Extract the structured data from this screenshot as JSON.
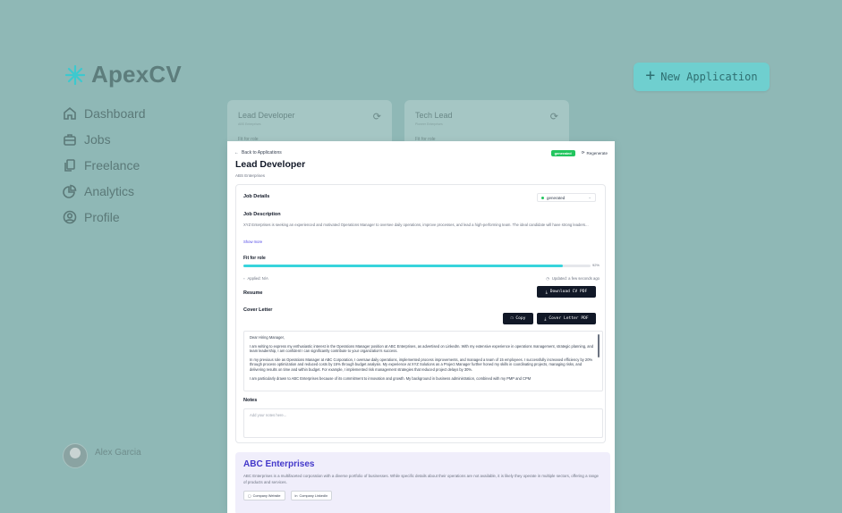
{
  "app": {
    "name": "ApexCV",
    "accent": "#6fcfcf"
  },
  "sidebar": {
    "items": [
      {
        "label": "Dashboard",
        "icon": "home-icon"
      },
      {
        "label": "Jobs",
        "icon": "briefcase-icon"
      },
      {
        "label": "Freelance",
        "icon": "document-icon"
      },
      {
        "label": "Analytics",
        "icon": "pie-chart-icon"
      },
      {
        "label": "Profile",
        "icon": "user-circle-icon"
      }
    ],
    "user": {
      "name": "Alex Garcia"
    }
  },
  "header": {
    "new_app_label": "New Application"
  },
  "bg_cards": [
    {
      "title": "Lead Developer",
      "company": "ABS Enterprises",
      "fit": "Fit for role"
    },
    {
      "title": "Tech Lead",
      "company": "Pioneer Enterprises",
      "fit": "Fit for role"
    }
  ],
  "panel": {
    "back_label": "Back to Applications",
    "status_badge": "generated",
    "regenerate_label": "Regenerate",
    "title": "Lead Developer",
    "company": "ABS Enterprises",
    "job_details_label": "Job Details",
    "status_select": "generated",
    "job_description_label": "Job Description",
    "job_description": "XYZ Enterprises is seeking an experienced and motivated Operations Manager to oversee daily operations, improve processes, and lead a high-performing team. The ideal candidate will have strong leaders...",
    "show_more": "Show more",
    "fit_label": "Fit for role",
    "fit_percent": 92,
    "fit_percent_text": "92%",
    "applied": "Applied: N/A",
    "updated": "Updated: a few seconds ago",
    "resume_label": "Resume",
    "download_cv": "Download CV PDF",
    "cover_letter_label": "Cover Letter",
    "copy_label": "Copy",
    "download_cover": "Cover Letter PDF",
    "letter": [
      "Dear Hiring Manager,",
      "I am writing to express my enthusiastic interest in the Operations Manager position at ABC Enterprises, as advertised on LinkedIn. With my extensive experience in operations management, strategic planning, and team leadership, I am confident I can significantly contribute to your organization's success.",
      "In my previous role as Operations Manager at ABC Corporation, I oversaw daily operations, implemented process improvements, and managed a team of 15 employees. I successfully increased efficiency by 20% through process optimization and reduced costs by 15% through budget analysis. My experience at XYZ Solutions as a Project Manager further honed my skills in coordinating projects, managing risks, and delivering results on time and within budget. For example, I implemented risk management strategies that reduced project delays by 30%.",
      "I am particularly drawn to ABC Enterprises because of its commitment to innovation and growth. My background in business administration, combined with my PMP and CPM"
    ],
    "notes_label": "Notes",
    "notes_placeholder": "Add your notes here..."
  },
  "company": {
    "name": "ABC Enterprises",
    "description": "ABC Enterprises is a multifaceted corporation with a diverse portfolio of businesses. While specific details about their operations are not available, it is likely they operate in multiple sectors, offering a range of products and services.",
    "website_label": "Company Website",
    "linkedin_label": "Company LinkedIn"
  }
}
